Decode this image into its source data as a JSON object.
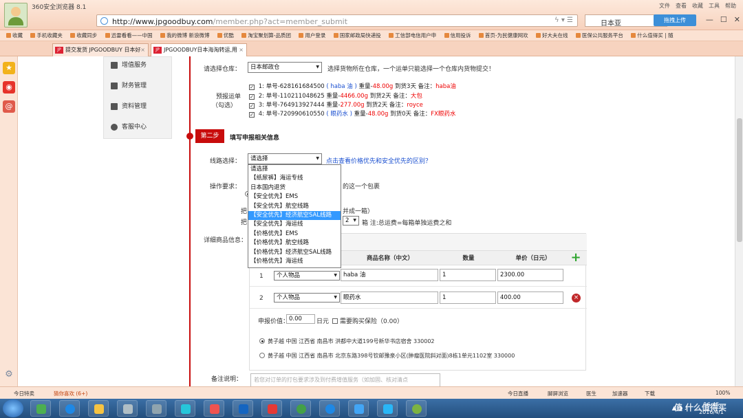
{
  "browser": {
    "title": "360安全浏览器 8.1",
    "url_host": "http://www.jpgoodbuy.com",
    "url_path": "/member.php?act=member_submit",
    "search_value": "日本亚",
    "upload_label": "拖拽上传",
    "menu": [
      "文件",
      "查看",
      "收藏",
      "工具",
      "帮助"
    ],
    "win_controls": [
      "—",
      "☐",
      "✕"
    ],
    "favorites": [
      "收藏",
      "手机收藏夹",
      "收藏同步",
      "迅雷看看——中国",
      "我的微博 新浪微博",
      "优酷",
      "淘宝聚划算-品质团",
      "用户登录",
      "国家邮政局快递投",
      "工信部电信用户申",
      "信用投诉",
      "首页-为民健康网欢",
      "好大夫在线",
      "医保公共服务平台",
      "什么值得买 | 随"
    ],
    "tabs": [
      {
        "label": "提交发货 JPGOODBUY 日本好",
        "close": "×"
      },
      {
        "label": "JPGOODBUY日本海淘转运,用",
        "close": "×"
      }
    ]
  },
  "sidebar_menu": [
    {
      "label": "增值服务"
    },
    {
      "label": "财务管理"
    },
    {
      "label": "资料管理"
    },
    {
      "label": "客服中心"
    }
  ],
  "form": {
    "warehouse_label": "请选择仓库：",
    "warehouse_value": "日本邮政仓",
    "warehouse_hint": "选择货物所在仓库，一个运单只能选择一个仓库内货物提交！",
    "prereport_label_1": "预报运单",
    "prereport_label_2": "（勾选）",
    "prereports": [
      {
        "idx": "1:",
        "no": "单号-628161684500",
        "name": "( haba 油 )",
        "weight_label": "重量-",
        "weight": "48.00g",
        "days": "到货3天",
        "note_label": "备注：",
        "note": "haba油"
      },
      {
        "idx": "2:",
        "no": "单号-110211048625",
        "name": "",
        "weight_label": "重量-",
        "weight": "4466.00g",
        "days": "到货2天",
        "note_label": "备注：",
        "note": "大包"
      },
      {
        "idx": "3:",
        "no": "单号-764913927444",
        "name": "",
        "weight_label": "重量-",
        "weight": "277.00g",
        "days": "到货2天",
        "note_label": "备注：",
        "note": "royce"
      },
      {
        "idx": "4:",
        "no": "单号-720990610550",
        "name": "( 眼药水 )",
        "weight_label": "重量-",
        "weight": "48.00g",
        "days": "到货0天",
        "note_label": "备注：",
        "note": "FX眼药水"
      }
    ],
    "check_mark": "✓",
    "step_badge": "第二步",
    "step_title": "填写申报相关信息",
    "route_label": "线路选择：",
    "route_value": "请选择",
    "route_link": "点击查看价格优先和安全优先的区别？",
    "route_options": [
      "请选择",
      "【纸尿裤】海运专线",
      "日本国内退货",
      "【安全优先】EMS",
      "【安全优先】航空线路",
      "【安全优先】经济航空SAL线路",
      "【安全优先】海运线",
      "【价格优先】EMS",
      "【价格优先】航空线路",
      "【价格优先】经济航空SAL线路",
      "【价格优先】海运线"
    ],
    "route_highlight_index": 5,
    "op_label": "操作要求：",
    "op_text_1": "的这一个包裹",
    "op_text_2": "并成一箱）",
    "op_prefix_1": "把",
    "op_prefix_2": "把",
    "box_count": "2",
    "box_note": "箱 注:总运费=每箱单独运费之和",
    "detail_label": "详细商品信息：",
    "table_headers": [
      "商品名称（中文）",
      "数量",
      "单价（日元）"
    ],
    "add_symbol": "+",
    "del_symbol": "×",
    "items": [
      {
        "no": "1",
        "category": "个人物品",
        "name": "haba 油",
        "qty": "1",
        "price": "2300.00"
      },
      {
        "no": "2",
        "category": "个人物品",
        "name": "眼药水",
        "qty": "1",
        "price": "400.00"
      }
    ],
    "declared_label": "申报价值：",
    "declared_value": "0.00",
    "declared_unit": "日元",
    "insurance_label": "需要购买保险（0.00）",
    "addresses": [
      "黄子越 中国 江西省 南昌市 洪都中大道199号新华书店宿舍 330002",
      "黄子越 中国 江西省 南昌市 北京东路398号钦邮豫泉小区(肿瘤医院斜对面)8栋1单元1102室 330000"
    ],
    "remark_label": "备注说明：",
    "remark_placeholder": "若您对订单的打包要求涉及到付费增值服务（如加固、核对清点"
  },
  "status_bar": {
    "left_1": "今日特卖",
    "left_2": "猜你喜欢 (6+)",
    "right": [
      "今日直播",
      "脚屏浏览",
      "医生",
      "加速器",
      "下载",
      "100%"
    ]
  },
  "taskbar": {
    "time": "16:45",
    "date": "2016/4/1",
    "watermark": "值 什么值得买"
  }
}
